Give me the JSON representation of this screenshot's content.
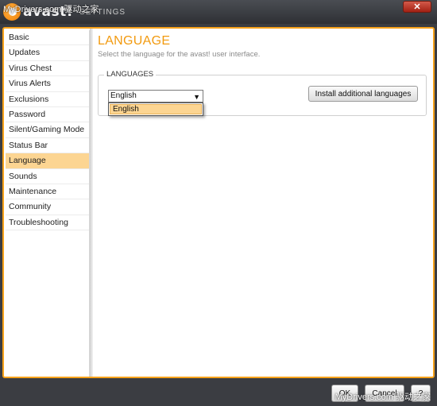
{
  "window": {
    "logo_text": "avast!",
    "title_suffix": "SETTINGS",
    "close_glyph": "✕",
    "watermark_top": "MyDrivers.com 驱动之家",
    "watermark_bottom": "MyDrivers.com 驱动之家"
  },
  "sidebar": {
    "items": [
      {
        "label": "Basic"
      },
      {
        "label": "Updates"
      },
      {
        "label": "Virus Chest"
      },
      {
        "label": "Virus Alerts"
      },
      {
        "label": "Exclusions"
      },
      {
        "label": "Password"
      },
      {
        "label": "Silent/Gaming Mode"
      },
      {
        "label": "Status Bar"
      },
      {
        "label": "Language",
        "active": true
      },
      {
        "label": "Sounds"
      },
      {
        "label": "Maintenance"
      },
      {
        "label": "Community"
      },
      {
        "label": "Troubleshooting"
      }
    ]
  },
  "page": {
    "title": "LANGUAGE",
    "subtitle": "Select the language for the avast! user interface.",
    "group_label": "LANGUAGES",
    "select_value": "English",
    "select_arrow": "▼",
    "dropdown_options": [
      "English"
    ],
    "install_button": "Install additional languages"
  },
  "footer": {
    "ok": "OK",
    "cancel": "Cancel",
    "help": "?"
  },
  "colors": {
    "accent": "#f7a21a",
    "selected_bg": "#fcd592",
    "title_bar": "#3b3d42",
    "close_button": "#c0392b"
  },
  "icons": {
    "logo": "avast-logo-icon",
    "close": "close-icon",
    "dropdown": "chevron-down-icon"
  }
}
